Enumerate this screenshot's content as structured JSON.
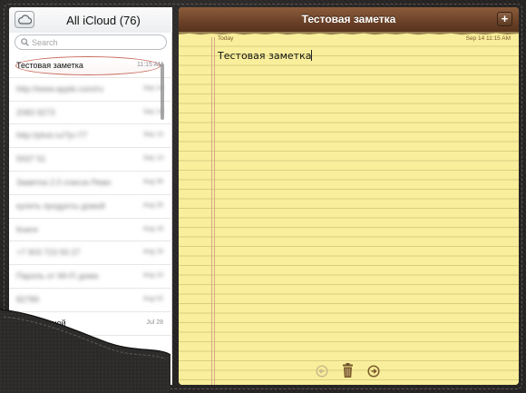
{
  "colors": {
    "leather": "#2a2827",
    "note_header": "#6a4127",
    "paper": "#f8ee9b",
    "selection_ring": "#c86a5a"
  },
  "sidebar": {
    "title": "All iCloud (76)",
    "cloud_icon": "cloud-icon",
    "search_placeholder": "Search",
    "notes": [
      {
        "title": "Тестовая заметка",
        "date": "11:15 AM",
        "selected": true,
        "blurred": false
      },
      {
        "title": "http://www.apple.com/ru",
        "date": "Sep 14",
        "selected": false,
        "blurred": true
      },
      {
        "title": "2083 9273",
        "date": "Sep 14",
        "selected": false,
        "blurred": true
      },
      {
        "title": "http://phot.ru/?p=77",
        "date": "Sep 13",
        "selected": false,
        "blurred": true
      },
      {
        "title": "5937 51",
        "date": "Sep 13",
        "selected": false,
        "blurred": true
      },
      {
        "title": "Заметка 2.0 список Ремо",
        "date": "Aug 30",
        "selected": false,
        "blurred": true
      },
      {
        "title": "купить продукты домой",
        "date": "Aug 26",
        "selected": false,
        "blurred": true
      },
      {
        "title": "Книги",
        "date": "Aug 18",
        "selected": false,
        "blurred": true
      },
      {
        "title": "+7 903 723 93 27",
        "date": "Aug 16",
        "selected": false,
        "blurred": true
      },
      {
        "title": "Пароль от Wi-Fi дома",
        "date": "Aug 10",
        "selected": false,
        "blurred": true
      },
      {
        "title": "82789",
        "date": "Aug 02",
        "selected": false,
        "blurred": true
      },
      {
        "title": "Стандартной",
        "date": "Jul 28",
        "selected": false,
        "blurred": false
      }
    ]
  },
  "note": {
    "title": "Тестовая заметка",
    "add_label": "+",
    "date_left": "Today",
    "date_right": "Sep 14  11:15 AM",
    "body": "Тестовая заметка",
    "toolbar": {
      "prev_icon": "arrow-left-icon",
      "trash_icon": "trash-icon",
      "next_icon": "arrow-right-icon"
    }
  }
}
